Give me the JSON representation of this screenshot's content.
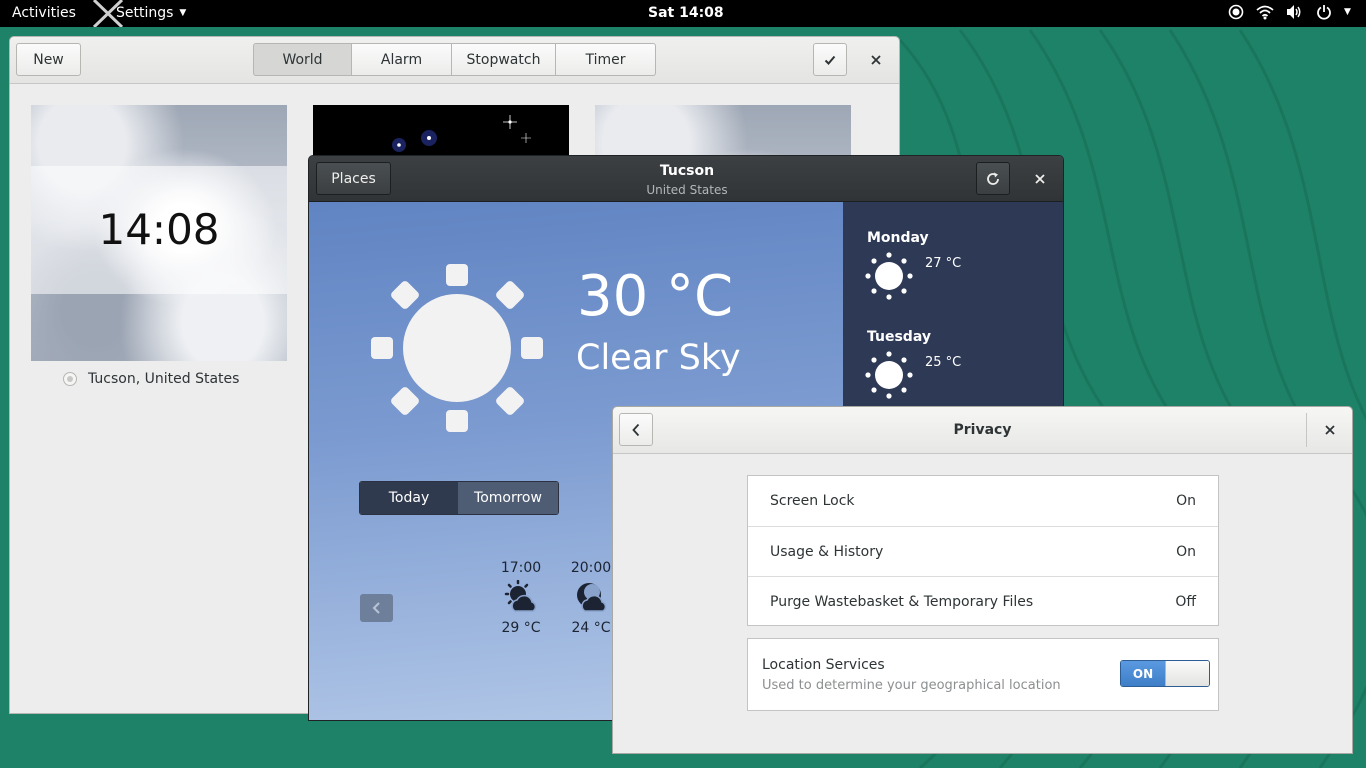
{
  "topbar": {
    "activities": "Activities",
    "app_menu": "Settings",
    "clock": "Sat 14:08"
  },
  "clocks": {
    "new_label": "New",
    "tabs": [
      "World",
      "Alarm",
      "Stopwatch",
      "Timer"
    ],
    "active_tab": "World",
    "tile_time": "14:08",
    "tile_caption": "Tucson, United States"
  },
  "weather": {
    "places_label": "Places",
    "title": "Tucson",
    "subtitle": "United States",
    "temperature": "30 °C",
    "condition": "Clear Sky",
    "day_tabs": [
      "Today",
      "Tomorrow"
    ],
    "hours": [
      {
        "time": "17:00",
        "temp": "29 °C"
      },
      {
        "time": "20:00",
        "temp": "24 °C"
      }
    ],
    "forecast": [
      {
        "day": "Monday",
        "temp": "27 °C"
      },
      {
        "day": "Tuesday",
        "temp": "25 °C"
      }
    ]
  },
  "privacy": {
    "title": "Privacy",
    "rows": [
      {
        "label": "Screen Lock",
        "value": "On"
      },
      {
        "label": "Usage & History",
        "value": "On"
      },
      {
        "label": "Purge Wastebasket & Temporary Files",
        "value": "Off"
      }
    ],
    "location": {
      "title": "Location Services",
      "subtitle": "Used to determine your geographical location",
      "switch_label": "ON"
    }
  },
  "colors": {
    "desktop": "#1e8268",
    "weather_sky": "#5b80c0",
    "forecast_panel": "#2e3a55",
    "switch_on": "#3d7ec8"
  }
}
